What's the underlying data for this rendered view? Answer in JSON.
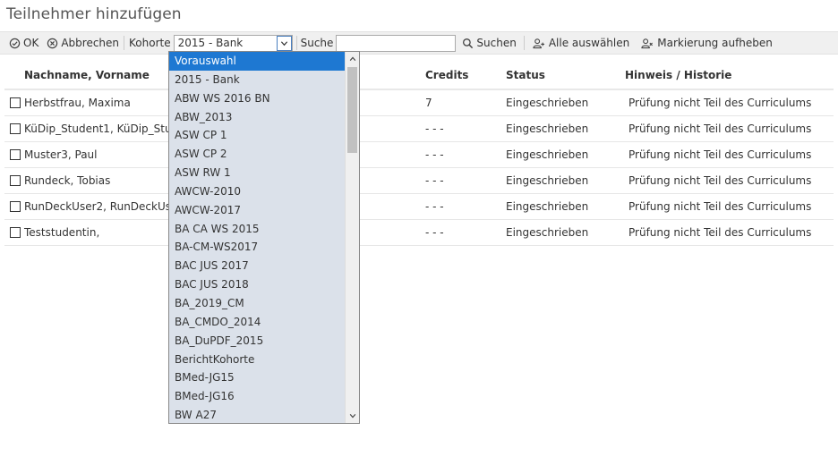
{
  "page": {
    "title": "Teilnehmer hinzufügen"
  },
  "toolbar": {
    "ok_label": "OK",
    "cancel_label": "Abbrechen",
    "cohort_label": "Kohorte",
    "cohort_selected": "2015 - Bank",
    "search_label": "Suche",
    "search_value": "",
    "search_button_label": "Suchen",
    "select_all_label": "Alle auswählen",
    "clear_selection_label": "Markierung aufheben"
  },
  "table": {
    "headers": {
      "name": "Nachname, Vorname",
      "credits": "Credits",
      "status": "Status",
      "hint": "Hinweis / Historie"
    },
    "rows": [
      {
        "name": "Herbstfrau, Maxima",
        "credits": "7",
        "status": "Eingeschrieben",
        "hint": "Prüfung nicht Teil des Curriculums"
      },
      {
        "name": "KüDip_Student1, KüDip_Student1",
        "credits": "- - -",
        "status": "Eingeschrieben",
        "hint": "Prüfung nicht Teil des Curriculums"
      },
      {
        "name": "Muster3, Paul",
        "credits": "- - -",
        "status": "Eingeschrieben",
        "hint": "Prüfung nicht Teil des Curriculums"
      },
      {
        "name": "Rundeck, Tobias",
        "credits": "- - -",
        "status": "Eingeschrieben",
        "hint": "Prüfung nicht Teil des Curriculums"
      },
      {
        "name": "RunDeckUser2, RunDeckUser2",
        "credits": "- - -",
        "status": "Eingeschrieben",
        "hint": "Prüfung nicht Teil des Curriculums"
      },
      {
        "name": "Teststudentin,",
        "credits": "- - -",
        "status": "Eingeschrieben",
        "hint": "Prüfung nicht Teil des Curriculums"
      }
    ]
  },
  "dropdown": {
    "highlighted": "Vorauswahl",
    "options": [
      "Vorauswahl",
      "2015 - Bank",
      "ABW WS 2016 BN",
      "ABW_2013",
      "ASW CP 1",
      "ASW CP 2",
      "ASW RW 1",
      "AWCW-2010",
      "AWCW-2017",
      "BA CA WS 2015",
      "BA-CM-WS2017",
      "BAC JUS 2017",
      "BAC JUS 2018",
      "BA_2019_CM",
      "BA_CMDO_2014",
      "BA_DuPDF_2015",
      "BerichtKohorte",
      "BMed-JG15",
      "BMed-JG16",
      "BW A27"
    ]
  },
  "colors": {
    "selected_bg": "#1e78d2",
    "dropdown_bg": "#dbe1ea",
    "toolbar_bg": "#f0f0f0"
  }
}
